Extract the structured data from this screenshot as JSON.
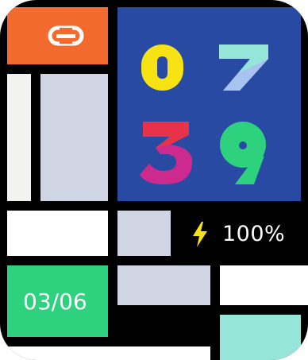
{
  "watchface": {
    "time": {
      "digit_1": "0",
      "digit_2": "7",
      "digit_3": "3",
      "digit_4": "9"
    },
    "battery": {
      "percent_text": "100%",
      "level": 100
    },
    "date": {
      "text": "03/06"
    },
    "icons": {
      "link": "link-icon",
      "bolt": "lightning-bolt-icon"
    },
    "colors": {
      "orange": "#f26a2e",
      "navy": "#284aa3",
      "green": "#2dd17e",
      "mint": "#95e6d9",
      "gray": "#cfd5e2",
      "yellow": "#f7e214"
    }
  }
}
